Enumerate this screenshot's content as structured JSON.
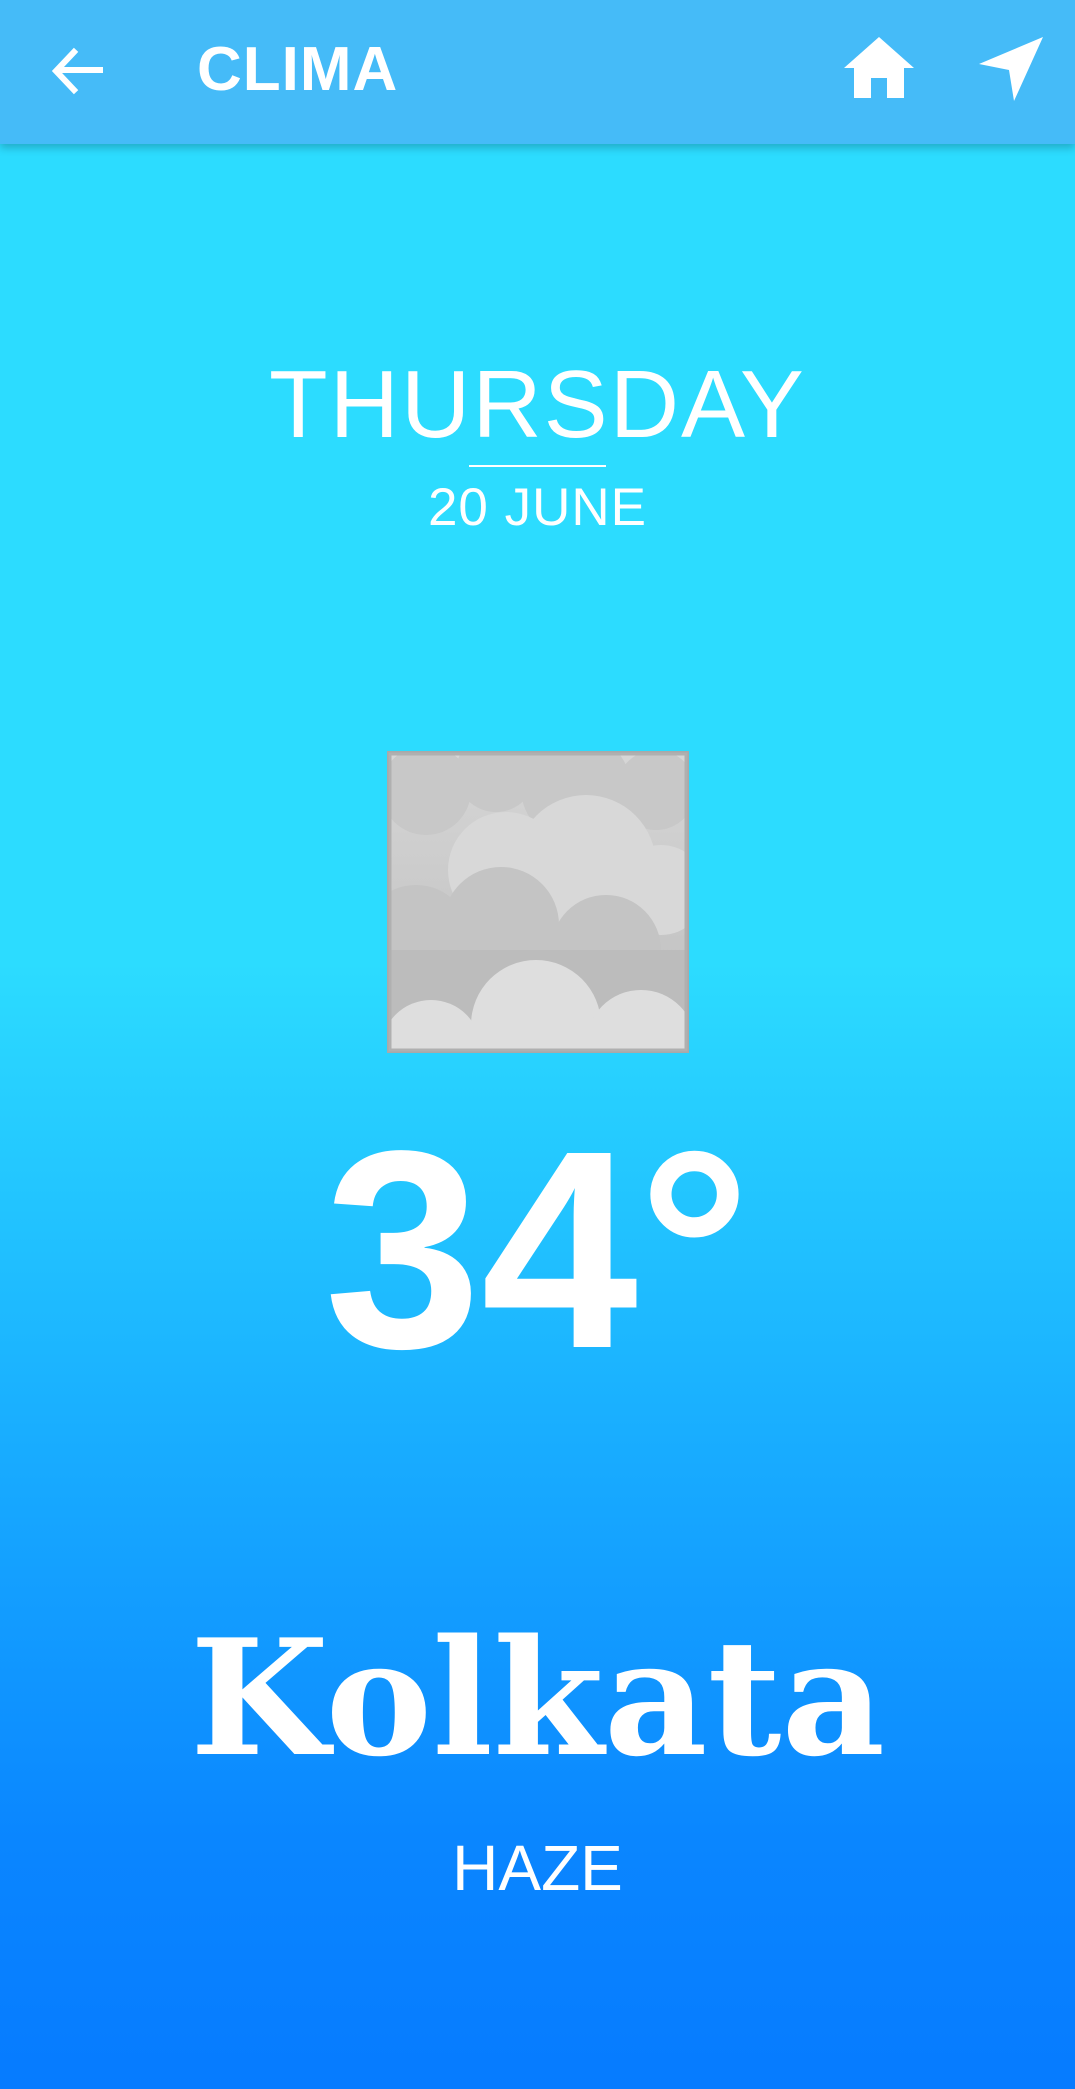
{
  "header": {
    "title": "CLIMA",
    "back_icon": "arrow-back-icon",
    "home_icon": "home-icon",
    "location_icon": "navigation-arrow-icon"
  },
  "weather": {
    "day": "THURSDAY",
    "date": "20 JUNE",
    "icon": "haze-clouds-icon",
    "temperature": "34°",
    "city": "Kolkata",
    "condition": "HAZE"
  },
  "colors": {
    "appbar": "#45bbf8",
    "gradient_top": "#2cdcff",
    "gradient_bottom": "#067bff",
    "text": "#ffffff"
  }
}
